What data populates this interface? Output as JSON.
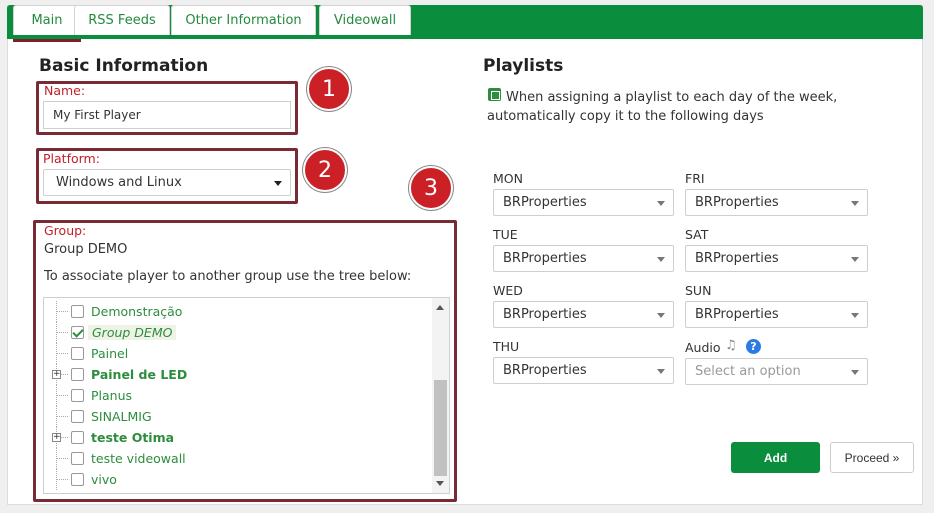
{
  "tabs": [
    {
      "label": "Main",
      "active": true
    },
    {
      "label": "RSS Feeds",
      "active": false
    },
    {
      "label": "Other Information",
      "active": false
    },
    {
      "label": "Videowall",
      "active": false
    }
  ],
  "basic": {
    "title": "Basic Information",
    "name_label": "Name:",
    "name_value": "My First Player",
    "platform_label": "Platform:",
    "platform_value": "Windows and Linux",
    "group_label": "Group:",
    "group_value": "Group DEMO",
    "tree_hint": "To associate player to another group use the tree below:"
  },
  "badges": [
    "1",
    "2",
    "3"
  ],
  "tree": {
    "items": [
      {
        "label": "Demonstração",
        "checked": false,
        "bold": false,
        "selected": false,
        "expandable": false
      },
      {
        "label": "Group DEMO",
        "checked": true,
        "bold": false,
        "selected": true,
        "expandable": false
      },
      {
        "label": "Painel",
        "checked": false,
        "bold": false,
        "selected": false,
        "expandable": false
      },
      {
        "label": "Painel de LED",
        "checked": false,
        "bold": true,
        "selected": false,
        "expandable": true
      },
      {
        "label": "Planus",
        "checked": false,
        "bold": false,
        "selected": false,
        "expandable": false
      },
      {
        "label": "SINALMIG",
        "checked": false,
        "bold": false,
        "selected": false,
        "expandable": false
      },
      {
        "label": "teste Otima",
        "checked": false,
        "bold": true,
        "selected": false,
        "expandable": true
      },
      {
        "label": "teste videowall",
        "checked": false,
        "bold": false,
        "selected": false,
        "expandable": false
      },
      {
        "label": "vivo",
        "checked": false,
        "bold": false,
        "selected": false,
        "expandable": false
      }
    ]
  },
  "playlists": {
    "title": "Playlists",
    "auto_copy_text": "When assigning a playlist to each day of the week, automatically copy it to the following days",
    "auto_copy_checked": true,
    "days": [
      {
        "label": "MON",
        "value": "BRProperties"
      },
      {
        "label": "TUE",
        "value": "BRProperties"
      },
      {
        "label": "WED",
        "value": "BRProperties"
      },
      {
        "label": "THU",
        "value": "BRProperties"
      },
      {
        "label": "FRI",
        "value": "BRProperties"
      },
      {
        "label": "SAT",
        "value": "BRProperties"
      },
      {
        "label": "SUN",
        "value": "BRProperties"
      }
    ],
    "audio_label": "Audio",
    "audio_placeholder": "Select an option"
  },
  "buttons": {
    "add": "Add",
    "proceed": "Proceed »"
  },
  "colors": {
    "brand_green": "#0a8e3e",
    "highlight_red": "#7a2a35",
    "badge_red": "#cc2027"
  }
}
